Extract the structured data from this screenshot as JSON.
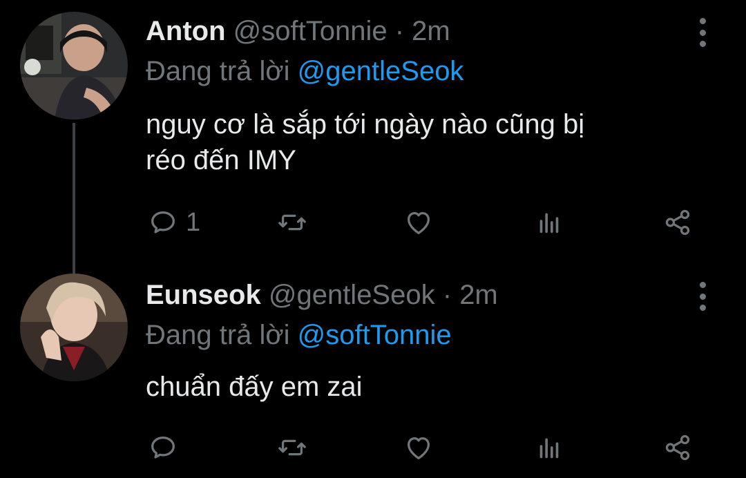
{
  "tweets": [
    {
      "name": "Anton",
      "handle": "@softTonnie",
      "sep": "·",
      "time": "2m",
      "reply_prefix": "Đang trả lời",
      "reply_mention": "@gentleSeok",
      "text_line1": "nguy cơ là sắp tới ngày nào cũng bị",
      "text_line2": "réo đến IMY",
      "reply_count": "1"
    },
    {
      "name": "Eunseok",
      "handle": "@gentleSeok",
      "sep": "·",
      "time": "2m",
      "reply_prefix": "Đang trả lời",
      "reply_mention": "@softTonnie",
      "text_line1": "chuẩn đấy em zai"
    }
  ],
  "colors": {
    "background": "#000000",
    "text": "#e7e9ea",
    "secondary": "#71767b",
    "accent": "#1d9bf0"
  }
}
